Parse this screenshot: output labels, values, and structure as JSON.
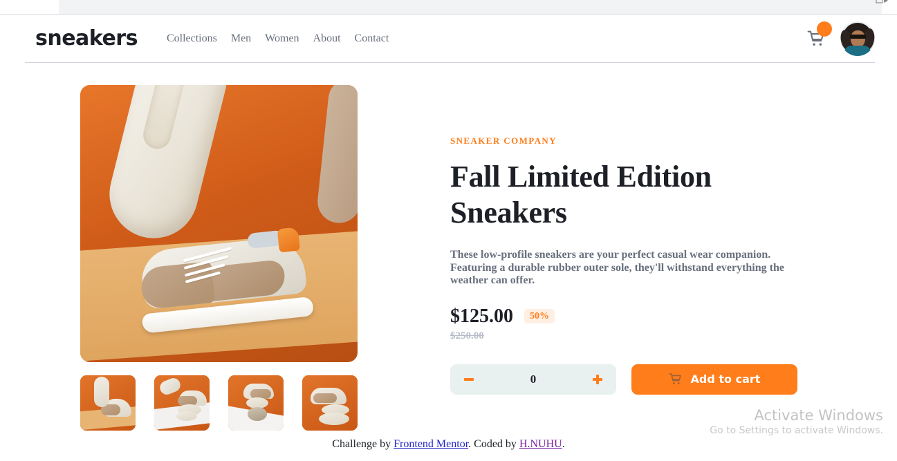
{
  "browser": {
    "tab_visible": true
  },
  "header": {
    "logo": "sneakers",
    "nav": [
      {
        "label": "Collections"
      },
      {
        "label": "Men"
      },
      {
        "label": "Women"
      },
      {
        "label": "About"
      },
      {
        "label": "Contact"
      }
    ],
    "cart_icon": "shopping-cart-icon",
    "cart_badge_count": "",
    "avatar_alt": "user-avatar"
  },
  "gallery": {
    "main_image_alt": "sneaker-product-photo-main",
    "thumbnails": [
      {
        "alt": "sneaker-thumbnail-1",
        "selected": true
      },
      {
        "alt": "sneaker-thumbnail-2",
        "selected": false
      },
      {
        "alt": "sneaker-thumbnail-3",
        "selected": false
      },
      {
        "alt": "sneaker-thumbnail-4",
        "selected": false
      }
    ]
  },
  "product": {
    "brand": "SNEAKER COMPANY",
    "title": "Fall Limited Edition Sneakers",
    "description": "These low-profile sneakers are your perfect casual wear companion. Featuring a durable rubber outer sole, they'll withstand everything the weather can offer.",
    "price_current": "$125.00",
    "discount_badge": "50%",
    "price_original": "$250.00",
    "quantity": "0",
    "decrease_label": "−",
    "increase_label": "+",
    "add_to_cart_label": "Add to cart",
    "add_to_cart_icon": "cart-icon"
  },
  "colors": {
    "accent_orange": "#FF7D1A",
    "badge_bg": "#FFEEE2",
    "dark_text": "#1D2026",
    "muted_text": "#68707D",
    "stepper_bg": "#E9F0F0",
    "old_price": "#B6BCC8"
  },
  "watermark": {
    "title": "Activate Windows",
    "subtitle": "Go to Settings to activate Windows."
  },
  "footer": {
    "prefix": "Challenge by ",
    "link1": "Frontend Mentor",
    "middle": ". Coded by ",
    "link2": "H.NUHU",
    "suffix": "."
  }
}
